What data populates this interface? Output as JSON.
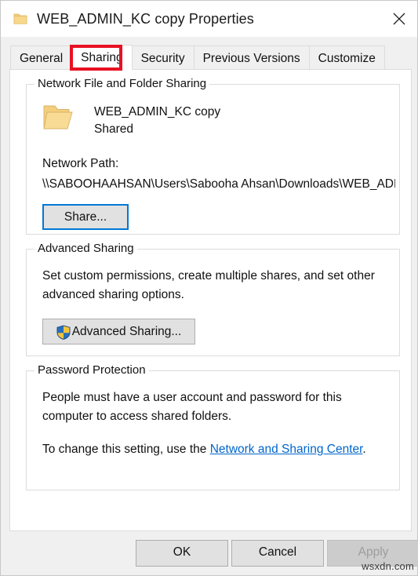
{
  "window": {
    "title": "WEB_ADMIN_KC copy Properties",
    "icon": "folder-icon",
    "close_icon": "close-icon"
  },
  "tabs": [
    {
      "label": "General",
      "selected": false
    },
    {
      "label": "Sharing",
      "selected": true
    },
    {
      "label": "Security",
      "selected": false
    },
    {
      "label": "Previous Versions",
      "selected": false
    },
    {
      "label": "Customize",
      "selected": false
    }
  ],
  "highlight": {
    "color": "#e81123",
    "target": "Sharing"
  },
  "network_sharing": {
    "group_title": "Network File and Folder Sharing",
    "folder_icon": "open-folder-icon",
    "folder_name": "WEB_ADMIN_KC copy",
    "folder_state": "Shared",
    "network_path_label": "Network Path:",
    "network_path_value": "\\\\SABOOHAAHSAN\\Users\\Sabooha Ahsan\\Downloads\\WEB_ADMIN_KC copy",
    "share_button": "Share..."
  },
  "advanced_sharing": {
    "group_title": "Advanced Sharing",
    "description": "Set custom permissions, create multiple shares, and set other advanced sharing options.",
    "button_label": "Advanced Sharing...",
    "button_icon": "uac-shield-icon"
  },
  "password_protection": {
    "group_title": "Password Protection",
    "description": "People must have a user account and password for this computer to access shared folders.",
    "change_prefix": "To change this setting, use the ",
    "change_link": "Network and Sharing Center",
    "change_suffix": "."
  },
  "footer": {
    "ok": "OK",
    "cancel": "Cancel",
    "apply": "Apply",
    "apply_disabled": true
  },
  "watermark": "wsxdn.com",
  "colors": {
    "accent": "#0078d7",
    "highlight": "#e81123",
    "link": "#0066cc",
    "folder": "#f5cf6e"
  }
}
